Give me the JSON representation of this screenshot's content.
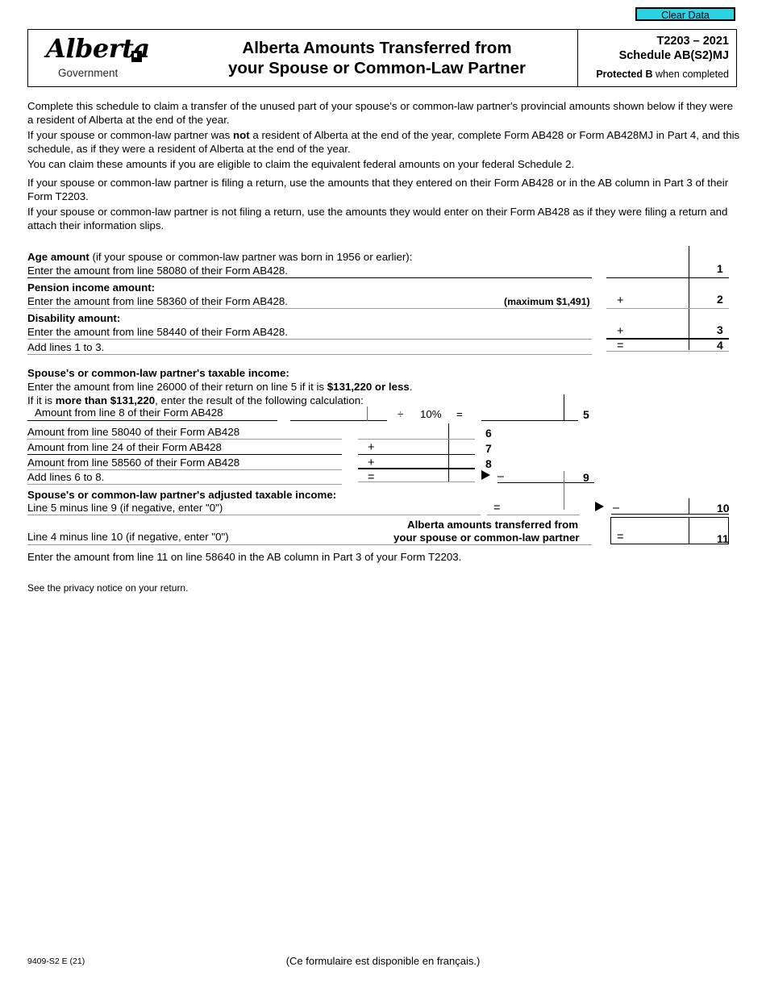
{
  "toolbar": {
    "clear_data_label": "Clear Data",
    "clear_data_color": "#2ad2e4"
  },
  "header": {
    "logo_wordmark": "Alberta",
    "logo_subtitle": "Government",
    "title_line1": "Alberta Amounts Transferred from",
    "title_line2": "your Spouse or Common-Law Partner",
    "form_number": "T2203 – 2021",
    "schedule": "Schedule AB(S2)MJ",
    "protected_bold": "Protected B",
    "protected_rest": " when completed"
  },
  "intro": {
    "p1": "Complete this schedule to claim a transfer of the unused part of your spouse's or common-law partner's provincial amounts shown below if they were a resident of Alberta at the end of the year.",
    "p2_a": "If your spouse or common-law partner was ",
    "p2_bold": "not",
    "p2_b": " a resident of Alberta at the end of the year, complete Form AB428 or Form AB428MJ in Part 4, and this schedule, as if they were a resident of Alberta at the end of the year.",
    "p3": "You can claim these amounts if you are eligible to claim the equivalent federal amounts on your federal Schedule 2.",
    "p4": "If your spouse or common-law partner is filing a return, use the amounts that they entered on their Form AB428 or in the AB column in Part 3 of their Form T2203.",
    "p5": "If your spouse or common-law partner is not filing a return, use the amounts they would enter on their Form AB428 as if they were filing a return and attach their information slips."
  },
  "section1": {
    "age_heading_bold": "Age amount",
    "age_heading_rest": " (if your spouse or common-law partner was born in 1956 or earlier):",
    "age_sub": "Enter the amount from line 58080 of their Form AB428.",
    "age_lineno": "1",
    "pension_heading": "Pension income amount:",
    "pension_sub": "Enter the amount from line 58360 of their Form AB428.",
    "pension_max": "(maximum $1,491)",
    "pension_op": "+",
    "pension_lineno": "2",
    "disability_heading": "Disability amount:",
    "disability_sub": "Enter the amount from line 58440 of their Form AB428.",
    "disability_op": "+",
    "disability_lineno": "3",
    "add_label": "Add lines 1 to 3.",
    "add_op": "=",
    "add_lineno": "4"
  },
  "section2": {
    "heading": "Spouse's or common-law partner's taxable income:",
    "sub1_a": "Enter the amount from line 26000 of their return on line 5 if it is ",
    "sub1_bold": "$131,220 or less",
    "sub1_b": ".",
    "sub2_a": "If it is ",
    "sub2_bold": "more than $131,220",
    "sub2_b": ", enter the result of the following calculation:",
    "calc_label": "Amount from line 8 of their Form AB428",
    "divide_op": "÷",
    "percent": "10%",
    "equals_op": "=",
    "line5_no": "5",
    "row6_label": "Amount from line 58040 of their Form AB428",
    "row6_no": "6",
    "row7_label": "Amount from line 24 of their Form AB428",
    "row7_op": "+",
    "row7_no": "7",
    "row8_label": "Amount from line 58560 of their Form AB428",
    "row8_op": "+",
    "row8_no": "8",
    "row9_label": "Add lines 6 to 8.",
    "row9_op": "=",
    "row9_minus": "–",
    "row9_no": "9"
  },
  "section3": {
    "heading": "Spouse's or common-law partner's adjusted taxable income:",
    "line10_label": "Line 5 minus line 9 (if negative, enter \"0\")",
    "line10_op": "=",
    "line10_minus": "–",
    "line10_no": "10",
    "line11_label": "Line 4 minus line 10 (if negative, enter \"0\")",
    "line11_caption1": "Alberta amounts transferred from",
    "line11_caption2": "your spouse or common-law partner",
    "line11_op": "=",
    "line11_no": "11",
    "closing": "Enter the amount from line 11 on line 58640 in the AB column in Part 3 of your Form T2203.",
    "privacy": "See the privacy notice on your return."
  },
  "footer": {
    "code": "9409-S2 E (21)",
    "french_note": "(Ce formulaire est disponible en français.)"
  }
}
